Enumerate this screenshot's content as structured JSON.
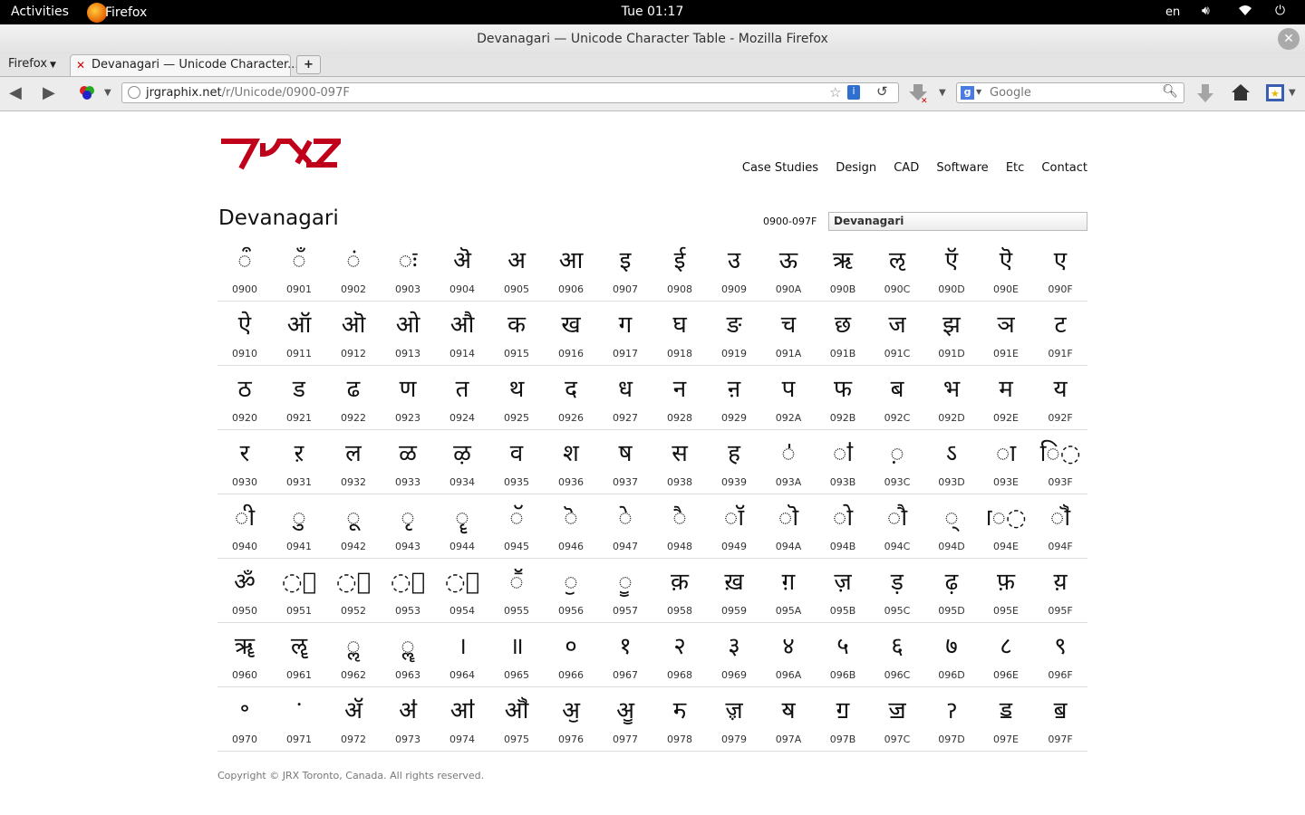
{
  "topbar": {
    "activities": "Activities",
    "app_name": "Firefox",
    "clock": "Tue 01:17",
    "language": "en"
  },
  "window": {
    "title": "Devanagari — Unicode Character Table - Mozilla Firefox"
  },
  "tabs": {
    "firefox_menu": "Firefox",
    "active_tab": "Devanagari — Unicode Character...",
    "new_tab": "+"
  },
  "navbar": {
    "url_host": "jrgraphix.net",
    "url_path": "/r/Unicode/0900-097F",
    "search_placeholder": "Google"
  },
  "site": {
    "nav": [
      "Case Studies",
      "Design",
      "CAD",
      "Software",
      "Etc",
      "Contact"
    ],
    "heading": "Devanagari",
    "range": "0900-097F",
    "block_selected": "Devanagari",
    "footer": "Copyright © JRX Toronto, Canada. All rights reserved."
  },
  "table": {
    "rows": [
      [
        {
          "ch": "◌ऀ",
          "code": "0900"
        },
        {
          "ch": "◌ँ",
          "code": "0901"
        },
        {
          "ch": "◌ं",
          "code": "0902"
        },
        {
          "ch": "◌ः",
          "code": "0903"
        },
        {
          "ch": "ऄ",
          "code": "0904"
        },
        {
          "ch": "अ",
          "code": "0905"
        },
        {
          "ch": "आ",
          "code": "0906"
        },
        {
          "ch": "इ",
          "code": "0907"
        },
        {
          "ch": "ई",
          "code": "0908"
        },
        {
          "ch": "उ",
          "code": "0909"
        },
        {
          "ch": "ऊ",
          "code": "090A"
        },
        {
          "ch": "ऋ",
          "code": "090B"
        },
        {
          "ch": "ऌ",
          "code": "090C"
        },
        {
          "ch": "ऍ",
          "code": "090D"
        },
        {
          "ch": "ऎ",
          "code": "090E"
        },
        {
          "ch": "ए",
          "code": "090F"
        }
      ],
      [
        {
          "ch": "ऐ",
          "code": "0910"
        },
        {
          "ch": "ऑ",
          "code": "0911"
        },
        {
          "ch": "ऒ",
          "code": "0912"
        },
        {
          "ch": "ओ",
          "code": "0913"
        },
        {
          "ch": "औ",
          "code": "0914"
        },
        {
          "ch": "क",
          "code": "0915"
        },
        {
          "ch": "ख",
          "code": "0916"
        },
        {
          "ch": "ग",
          "code": "0917"
        },
        {
          "ch": "घ",
          "code": "0918"
        },
        {
          "ch": "ङ",
          "code": "0919"
        },
        {
          "ch": "च",
          "code": "091A"
        },
        {
          "ch": "छ",
          "code": "091B"
        },
        {
          "ch": "ज",
          "code": "091C"
        },
        {
          "ch": "झ",
          "code": "091D"
        },
        {
          "ch": "ञ",
          "code": "091E"
        },
        {
          "ch": "ट",
          "code": "091F"
        }
      ],
      [
        {
          "ch": "ठ",
          "code": "0920"
        },
        {
          "ch": "ड",
          "code": "0921"
        },
        {
          "ch": "ढ",
          "code": "0922"
        },
        {
          "ch": "ण",
          "code": "0923"
        },
        {
          "ch": "त",
          "code": "0924"
        },
        {
          "ch": "थ",
          "code": "0925"
        },
        {
          "ch": "द",
          "code": "0926"
        },
        {
          "ch": "ध",
          "code": "0927"
        },
        {
          "ch": "न",
          "code": "0928"
        },
        {
          "ch": "ऩ",
          "code": "0929"
        },
        {
          "ch": "प",
          "code": "092A"
        },
        {
          "ch": "फ",
          "code": "092B"
        },
        {
          "ch": "ब",
          "code": "092C"
        },
        {
          "ch": "भ",
          "code": "092D"
        },
        {
          "ch": "म",
          "code": "092E"
        },
        {
          "ch": "य",
          "code": "092F"
        }
      ],
      [
        {
          "ch": "र",
          "code": "0930"
        },
        {
          "ch": "ऱ",
          "code": "0931"
        },
        {
          "ch": "ल",
          "code": "0932"
        },
        {
          "ch": "ळ",
          "code": "0933"
        },
        {
          "ch": "ऴ",
          "code": "0934"
        },
        {
          "ch": "व",
          "code": "0935"
        },
        {
          "ch": "श",
          "code": "0936"
        },
        {
          "ch": "ष",
          "code": "0937"
        },
        {
          "ch": "स",
          "code": "0938"
        },
        {
          "ch": "ह",
          "code": "0939"
        },
        {
          "ch": "◌ऺ",
          "code": "093A"
        },
        {
          "ch": "◌ऻ",
          "code": "093B"
        },
        {
          "ch": "◌़",
          "code": "093C"
        },
        {
          "ch": "ऽ",
          "code": "093D"
        },
        {
          "ch": "◌ा",
          "code": "093E"
        },
        {
          "ch": "ि◌",
          "code": "093F"
        }
      ],
      [
        {
          "ch": "◌ी",
          "code": "0940"
        },
        {
          "ch": "◌ु",
          "code": "0941"
        },
        {
          "ch": "◌ू",
          "code": "0942"
        },
        {
          "ch": "◌ृ",
          "code": "0943"
        },
        {
          "ch": "◌ॄ",
          "code": "0944"
        },
        {
          "ch": "◌ॅ",
          "code": "0945"
        },
        {
          "ch": "◌ॆ",
          "code": "0946"
        },
        {
          "ch": "◌े",
          "code": "0947"
        },
        {
          "ch": "◌ै",
          "code": "0948"
        },
        {
          "ch": "◌ॉ",
          "code": "0949"
        },
        {
          "ch": "◌ॊ",
          "code": "094A"
        },
        {
          "ch": "◌ो",
          "code": "094B"
        },
        {
          "ch": "◌ौ",
          "code": "094C"
        },
        {
          "ch": "◌्",
          "code": "094D"
        },
        {
          "ch": "ॎ◌",
          "code": "094E"
        },
        {
          "ch": "◌ॏ",
          "code": "094F"
        }
      ],
      [
        {
          "ch": "ॐ",
          "code": "0950"
        },
        {
          "ch": "◌॑",
          "code": "0951"
        },
        {
          "ch": "◌॒",
          "code": "0952"
        },
        {
          "ch": "◌॓",
          "code": "0953"
        },
        {
          "ch": "◌॔",
          "code": "0954"
        },
        {
          "ch": "◌ॕ",
          "code": "0955"
        },
        {
          "ch": "◌ॖ",
          "code": "0956"
        },
        {
          "ch": "◌ॗ",
          "code": "0957"
        },
        {
          "ch": "क़",
          "code": "0958"
        },
        {
          "ch": "ख़",
          "code": "0959"
        },
        {
          "ch": "ग़",
          "code": "095A"
        },
        {
          "ch": "ज़",
          "code": "095B"
        },
        {
          "ch": "ड़",
          "code": "095C"
        },
        {
          "ch": "ढ़",
          "code": "095D"
        },
        {
          "ch": "फ़",
          "code": "095E"
        },
        {
          "ch": "य़",
          "code": "095F"
        }
      ],
      [
        {
          "ch": "ॠ",
          "code": "0960"
        },
        {
          "ch": "ॡ",
          "code": "0961"
        },
        {
          "ch": "◌ॢ",
          "code": "0962"
        },
        {
          "ch": "◌ॣ",
          "code": "0963"
        },
        {
          "ch": "।",
          "code": "0964"
        },
        {
          "ch": "॥",
          "code": "0965"
        },
        {
          "ch": "०",
          "code": "0966"
        },
        {
          "ch": "१",
          "code": "0967"
        },
        {
          "ch": "२",
          "code": "0968"
        },
        {
          "ch": "३",
          "code": "0969"
        },
        {
          "ch": "४",
          "code": "096A"
        },
        {
          "ch": "५",
          "code": "096B"
        },
        {
          "ch": "६",
          "code": "096C"
        },
        {
          "ch": "७",
          "code": "096D"
        },
        {
          "ch": "८",
          "code": "096E"
        },
        {
          "ch": "९",
          "code": "096F"
        }
      ],
      [
        {
          "ch": "॰",
          "code": "0970"
        },
        {
          "ch": "ॱ",
          "code": "0971"
        },
        {
          "ch": "ॲ",
          "code": "0972"
        },
        {
          "ch": "ॳ",
          "code": "0973"
        },
        {
          "ch": "ॴ",
          "code": "0974"
        },
        {
          "ch": "ॵ",
          "code": "0975"
        },
        {
          "ch": "ॶ",
          "code": "0976"
        },
        {
          "ch": "ॷ",
          "code": "0977"
        },
        {
          "ch": "ॸ",
          "code": "0978"
        },
        {
          "ch": "ॹ",
          "code": "0979"
        },
        {
          "ch": "ॺ",
          "code": "097A"
        },
        {
          "ch": "ॻ",
          "code": "097B"
        },
        {
          "ch": "ॼ",
          "code": "097C"
        },
        {
          "ch": "ॽ",
          "code": "097D"
        },
        {
          "ch": "ॾ",
          "code": "097E"
        },
        {
          "ch": "ॿ",
          "code": "097F"
        }
      ]
    ]
  }
}
